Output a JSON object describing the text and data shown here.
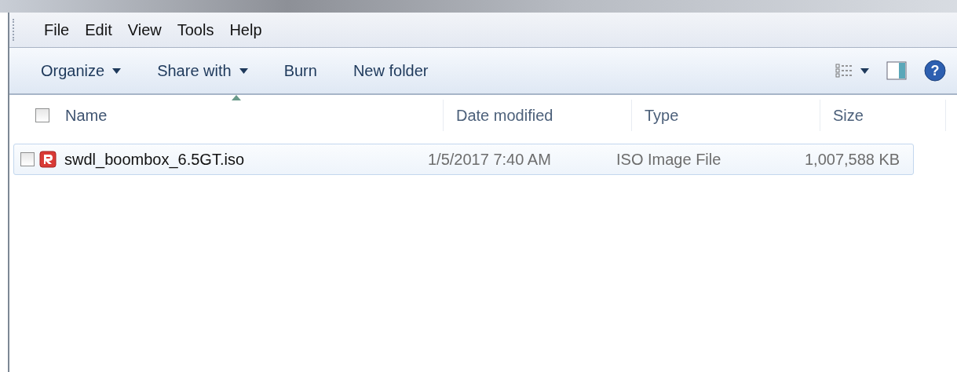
{
  "menu_bar": {
    "items": [
      "File",
      "Edit",
      "View",
      "Tools",
      "Help"
    ]
  },
  "toolbar": {
    "buttons": [
      {
        "label": "Organize",
        "kind": "dropdown"
      },
      {
        "label": "Share with",
        "kind": "dropdown"
      },
      {
        "label": "Burn",
        "kind": "plain"
      },
      {
        "label": "New folder",
        "kind": "plain"
      }
    ],
    "help_glyph": "?"
  },
  "file_list": {
    "select_all_checked": false,
    "columns": [
      {
        "label": "Name",
        "sorted": true
      },
      {
        "label": "Date modified",
        "sorted": false
      },
      {
        "label": "Type",
        "sorted": false
      },
      {
        "label": "Size",
        "sorted": false
      }
    ],
    "rows": [
      {
        "name": "swdl_boombox_6.5GT.iso",
        "date_modified": "1/5/2017 7:40 AM",
        "type": "ISO Image File",
        "size": "1,007,588 KB",
        "checked": false,
        "selected": true
      }
    ]
  }
}
